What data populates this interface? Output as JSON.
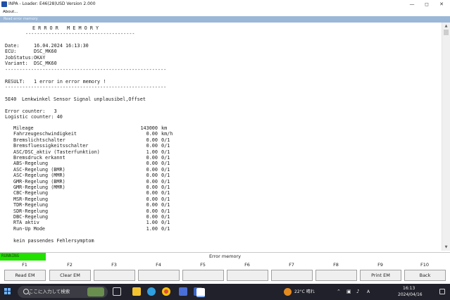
{
  "window": {
    "title": "INPA - Loader: E46(28)USD Version 2.000",
    "menu_item": "About...",
    "subwindow_title": "Read error memory"
  },
  "report": {
    "heading": "E R R O R   M E M O R Y",
    "heading_rule": "--------------------------------------",
    "rule": "---------------------------------------------------------------",
    "info": [
      {
        "label": "Date:",
        "value": "16.04.2024 16:13:30"
      },
      {
        "label": "ECU:",
        "value": "DSC_MK60"
      },
      {
        "label": "JobStatus:",
        "value": "OKAY"
      },
      {
        "label": "Variant:",
        "value": "DSC_MK60"
      }
    ],
    "result_label": "RESULT:",
    "result_value": "1 error in error memory !",
    "fault_code": "5E40",
    "fault_text": "Lenkwinkel Sensor Signal unplausibel,Offset",
    "error_counter": "Error counter:   3",
    "logistic_counter": "Logistic counter: 40",
    "conditions": [
      {
        "name": "Mileage",
        "value": "143000",
        "unit": "km"
      },
      {
        "name": "Fahrzeugeschwindigkeit",
        "value": "0.00",
        "unit": "km/h"
      },
      {
        "name": "Bremslichtschalter",
        "value": "0.00",
        "unit": "0/1"
      },
      {
        "name": "Bremsfluessigkeitsschalter",
        "value": "0.00",
        "unit": "0/1"
      },
      {
        "name": "ASC/DSC_aktiv (Tasterfunktion)",
        "value": "1.00",
        "unit": "0/1"
      },
      {
        "name": "Bremsdruck erkannt",
        "value": "0.00",
        "unit": "0/1"
      },
      {
        "name": "ABS-Regelung",
        "value": "0.00",
        "unit": "0/1"
      },
      {
        "name": "ASC-Regelung (BMR)",
        "value": "0.00",
        "unit": "0/1"
      },
      {
        "name": "ASC-Regelung (MMR)",
        "value": "0.00",
        "unit": "0/1"
      },
      {
        "name": "GMR-Regelung (BMR)",
        "value": "0.00",
        "unit": "0/1"
      },
      {
        "name": "GMR-Regelung (MMR)",
        "value": "0.00",
        "unit": "0/1"
      },
      {
        "name": "CBC-Regelung",
        "value": "0.00",
        "unit": "0/1"
      },
      {
        "name": "MSR-Regelung",
        "value": "0.00",
        "unit": "0/1"
      },
      {
        "name": "TDR-Regelung",
        "value": "0.00",
        "unit": "0/1"
      },
      {
        "name": "SDR-Regelung",
        "value": "0.00",
        "unit": "0/1"
      },
      {
        "name": "DBC-Regelung",
        "value": "0.00",
        "unit": "0/1"
      },
      {
        "name": "RTA aktiv",
        "value": "1.00",
        "unit": "0/1"
      },
      {
        "name": "Run-Up Mode",
        "value": "1.00",
        "unit": "0/1"
      }
    ],
    "footer": "kein passendes Fehlersymptom"
  },
  "status": {
    "code": "RUNNING",
    "title": "Error memory",
    "color": "#22e000"
  },
  "fkeys": [
    {
      "key": "F1",
      "label": "Read EM"
    },
    {
      "key": "F2",
      "label": "Clear EM"
    },
    {
      "key": "F3",
      "label": ""
    },
    {
      "key": "F4",
      "label": ""
    },
    {
      "key": "F5",
      "label": ""
    },
    {
      "key": "F6",
      "label": ""
    },
    {
      "key": "F7",
      "label": ""
    },
    {
      "key": "F8",
      "label": ""
    },
    {
      "key": "F9",
      "label": "Print EM"
    },
    {
      "key": "F10",
      "label": "Back"
    }
  ],
  "taskbar": {
    "search_placeholder": "ここに入力して検索",
    "weather": "22°C  晴れ",
    "ime": "A",
    "time": "16:13",
    "date": "2024/04/16",
    "icons": [
      "task-view-icon",
      "file-explorer-icon",
      "edge-icon",
      "chrome-icon",
      "mail-icon",
      "store-icon",
      "app-icon",
      "inpa-icon"
    ]
  }
}
